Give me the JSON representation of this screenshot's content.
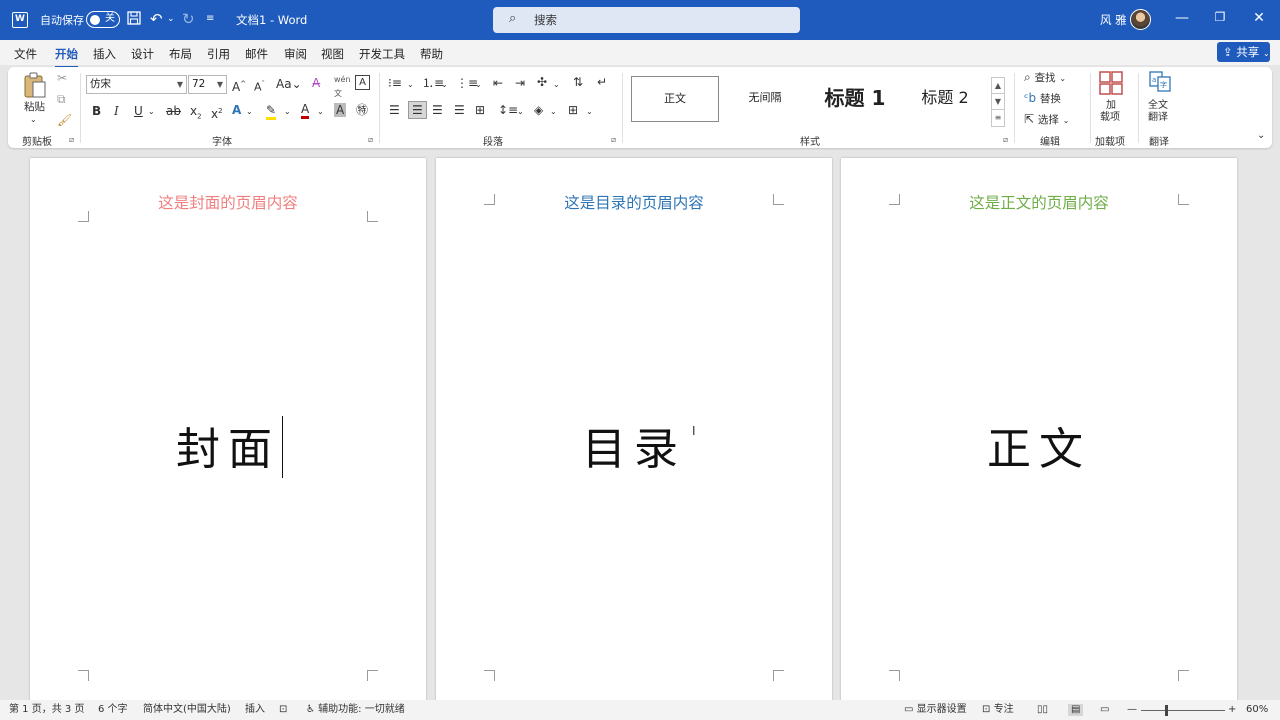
{
  "titlebar": {
    "app_icon": "word-logo-icon",
    "app_icon_letter": "W",
    "autosave_label": "自动保存",
    "autosave_state": "关",
    "doc_title": "文档1 - Word",
    "search_placeholder": "搜索",
    "user_name": "风 雅",
    "icons": [
      "save-icon",
      "undo-icon",
      "redo-icon",
      "minimize-icon",
      "restore-icon",
      "close-icon"
    ]
  },
  "tabs": [
    {
      "label": "文件",
      "active": false
    },
    {
      "label": "开始",
      "active": true
    },
    {
      "label": "插入",
      "active": false
    },
    {
      "label": "设计",
      "active": false
    },
    {
      "label": "布局",
      "active": false
    },
    {
      "label": "引用",
      "active": false
    },
    {
      "label": "邮件",
      "active": false
    },
    {
      "label": "审阅",
      "active": false
    },
    {
      "label": "视图",
      "active": false
    },
    {
      "label": "开发工具",
      "active": false
    },
    {
      "label": "帮助",
      "active": false
    }
  ],
  "share_label": "共享",
  "ribbon": {
    "clipboard": {
      "paste_label": "粘贴",
      "group_label": "剪贴板"
    },
    "font": {
      "font_name": "仿宋",
      "font_size": "72",
      "group_label": "字体"
    },
    "paragraph": {
      "group_label": "段落"
    },
    "styles": {
      "items": [
        "正文",
        "无间隔",
        "标题 1",
        "标题 2"
      ],
      "selected": "正文",
      "group_label": "样式"
    },
    "editing": {
      "find_label": "查找",
      "replace_label": "替换",
      "select_label": "选择",
      "group_label": "编辑"
    },
    "addins": {
      "button_label_1": "加",
      "button_label_2": "载项",
      "group_label": "加载项"
    },
    "translate": {
      "button_label_1": "全文",
      "button_label_2": "翻译",
      "group_label": "翻译"
    }
  },
  "pages": [
    {
      "header": "这是封面的页眉内容",
      "header_color": "#f07f7f",
      "body": "封面"
    },
    {
      "header": "这是目录的页眉内容",
      "header_color": "#2e75b6",
      "body": "目录"
    },
    {
      "header": "这是正文的页眉内容",
      "header_color": "#70ad47",
      "body": "正文"
    }
  ],
  "statusbar": {
    "page_info": "第 1 页，共 3 页",
    "word_count": "6 个字",
    "language": "简体中文(中国大陆)",
    "mode": "插入",
    "accessibility": "辅助功能: 一切就绪",
    "display_settings": "显示器设置",
    "focus": "专注",
    "zoom": "60%"
  }
}
